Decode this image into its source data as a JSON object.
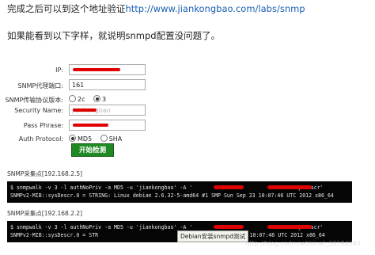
{
  "intro": {
    "line1_text": "完成之后可以到这个地址验证",
    "line1_link": "http://www.jiankongbao.com/labs/snmp",
    "line2_text": "如果能看到以下字样，就说明snmpd配置没问题了。"
  },
  "form": {
    "ip_label": "IP:",
    "port_label": "SNMP代理端口:",
    "port_value": "161",
    "version_label": "SNMP传输协议版本:",
    "version_options": [
      "2c",
      "3"
    ],
    "version_selected": "3",
    "security_label": "Security Name:",
    "security_value": "jiankongbao",
    "pass_label": "Pass Phrase:",
    "auth_label": "Auth Protocol:",
    "auth_options": [
      "MD5",
      "SHA"
    ],
    "auth_selected": "MD5",
    "submit_label": "开始检测"
  },
  "results": [
    {
      "title": "SNMP采集点[192.168.2.5]",
      "line1": "$ snmpwalk -v 3 -l authNoPriv -a MD5 -u 'jiankongbao' -A '",
      "line1_mid": "' -x '",
      "line1_tail": "' 'sysDescr'",
      "line2": "SNMPv2-MIB::sysDescr.0 = STRING: Linux debian 2.6.32-5-amd64 #1 SMP Sun Sep 23 10:07:46 UTC 2012 x86_64"
    },
    {
      "title": "SNMP采集点[192.168.2.2]",
      "line1": "$ snmpwalk -v 3 -l authNoPriv -a MD5 -u 'jiankongbao' -A '",
      "line1_mid": "' -x '",
      "line1_tail": "' 'sysDescr'",
      "line2_a": "SNMPv2-MIB::sysDescr.0 = STR",
      "line2_b": "64 #1 SMP Sun Sep 23 10:07:46 UTC 2012 x86_64"
    }
  ],
  "tooltip": "Debian安装snmpd测试",
  "watermark": "http://blog.csdn.net/sinat_33184263",
  "colors": {
    "link": "#1a5fb4",
    "button": "#1f8a24",
    "redaction": "#e00000",
    "terminal_bg": "#050505"
  }
}
